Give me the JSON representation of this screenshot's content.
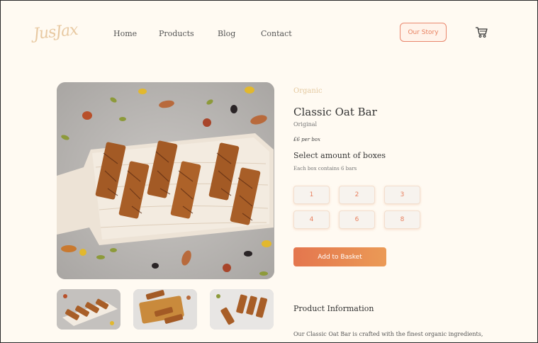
{
  "brand": {
    "logo_text": "JusJax"
  },
  "nav": {
    "items": [
      {
        "label": "Home"
      },
      {
        "label": "Products"
      },
      {
        "label": "Blog"
      },
      {
        "label": "Contact"
      }
    ],
    "story_button": "Our Story",
    "cart_icon": "shopping-cart-icon"
  },
  "product": {
    "category": "Organic",
    "title": "Classic Oat Bar",
    "variant": "Original",
    "price": "£6 per box",
    "select_heading": "Select amount of boxes",
    "box_note": "Each box contains 6 bars",
    "quantities": [
      "1",
      "2",
      "3",
      "4",
      "6",
      "8"
    ],
    "add_button": "Add to Basket",
    "info_heading": "Product Information",
    "info_text": "Our Classic Oat Bar is crafted with the finest organic ingredients,"
  },
  "colors": {
    "background": "#fffaf2",
    "accent": "#e8805f",
    "logo": "#e8c9a2"
  }
}
